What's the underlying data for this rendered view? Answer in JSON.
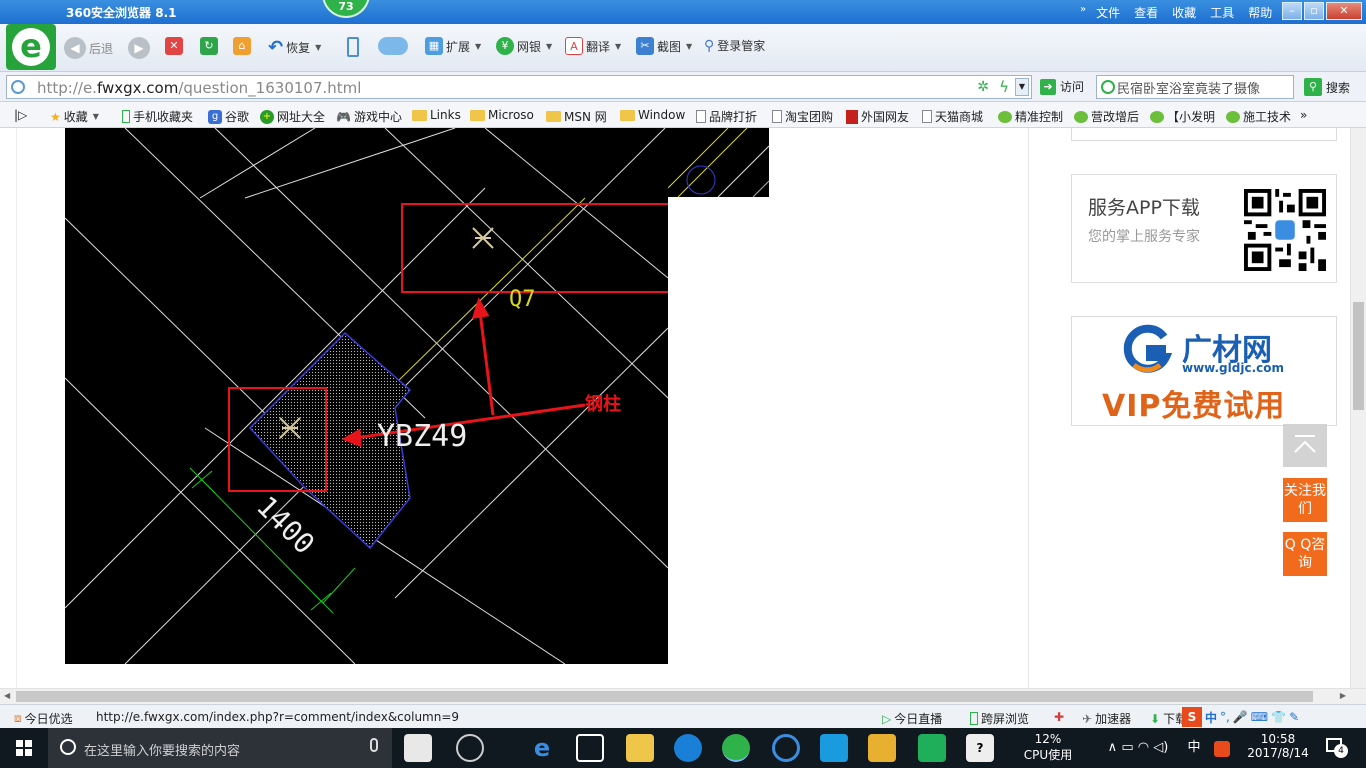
{
  "window": {
    "title": "360安全浏览器 8.1",
    "badge": "73",
    "menu": [
      "文件",
      "查看",
      "收藏",
      "工具",
      "帮助"
    ]
  },
  "toolbar": {
    "back_label": "后退",
    "restore_label": "恢复",
    "extend_label": "扩展",
    "bank_label": "网银",
    "translate_label": "翻译",
    "screenshot_label": "截图",
    "login_label": "登录管家"
  },
  "address": {
    "url_prefix": "http://e.",
    "url_domain": "fwxgx.com",
    "url_path": "/question_1630107.html",
    "visit_label": "访问",
    "search_placeholder": "民宿卧室浴室竟装了摄像",
    "search_label": "搜索"
  },
  "bookmarks": {
    "items": [
      "收藏",
      "手机收藏夹",
      "谷歌",
      "网址大全",
      "游戏中心",
      "Links",
      "Microso",
      "MSN 网",
      "Window",
      "品牌打折",
      "淘宝团购",
      "外国网友",
      "天猫商城",
      "精准控制",
      "营改增后",
      "【小发明",
      "施工技术"
    ]
  },
  "cad": {
    "label_q7": "Q7",
    "label_ybz": "YBZ49",
    "label_dim": "1400",
    "annotation": "钢柱",
    "colors": {
      "annotation": "#e8141b",
      "hatch": "#3a3ad6",
      "axis": "#d8d820",
      "dim": "#21c521"
    }
  },
  "sidebar": {
    "app_title": "服务APP下载",
    "app_subtitle": "您的掌上服务专家",
    "ad_brand": "广材网",
    "ad_domain": "www.gldjc.com",
    "ad_vip": "VIP免费试用",
    "follow_label": "关注我们",
    "qq_label": "Q Q咨询"
  },
  "statusbar": {
    "today_pick": "今日优选",
    "link_url": "http://e.fwxgx.com/index.php?r=comment/index&column=9",
    "today_live": "今日直播",
    "cross_screen": "跨屏浏览",
    "accelerator": "加速器",
    "download": "下载"
  },
  "taskbar": {
    "search_placeholder": "在这里输入你要搜索的内容",
    "cpu_percent": "12%",
    "cpu_label": "CPU使用",
    "ime": "中",
    "time": "10:58",
    "date": "2017/8/14",
    "notifications": "4"
  }
}
